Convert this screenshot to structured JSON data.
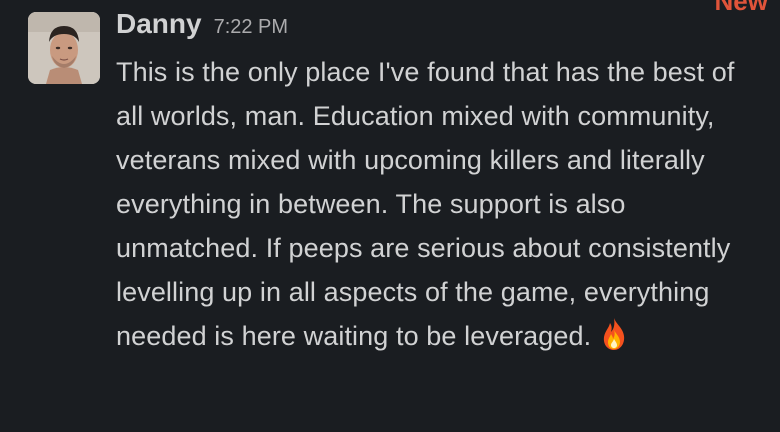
{
  "new_indicator": "New",
  "message": {
    "author": "Danny",
    "time": "7:22 PM",
    "text": "This is the only place I've found that has the best of all worlds, man. Education mixed with community, veterans mixed with upcoming killers and literally everything in between. The support is also unmatched. If peeps are serious about consistently levelling up in all aspects of the game, everything needed is here waiting to be leveraged.",
    "emoji": "fire-emoji"
  },
  "colors": {
    "background": "#1a1d21",
    "text": "#d1d2d3",
    "muted": "#ababad",
    "new_accent": "#e0543a"
  }
}
